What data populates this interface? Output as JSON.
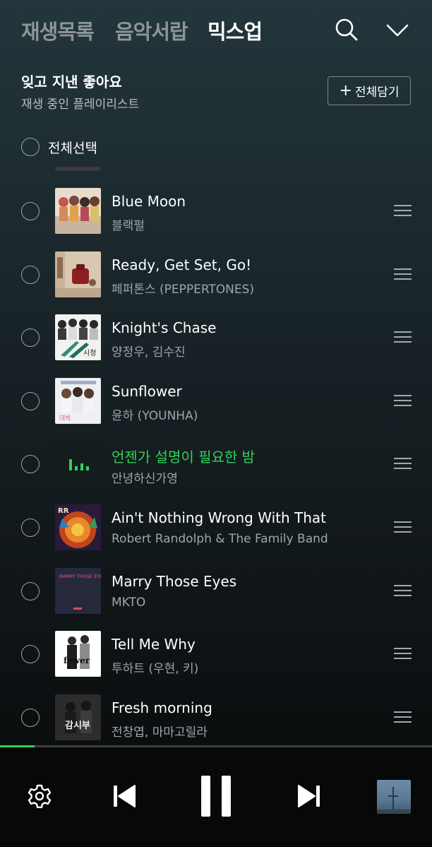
{
  "tabs": [
    {
      "label": "재생목록",
      "active": false
    },
    {
      "label": "음악서랍",
      "active": false
    },
    {
      "label": "믹스업",
      "active": true
    }
  ],
  "icons": {
    "search": "search-icon",
    "collapse": "chevron-down-icon"
  },
  "playlist": {
    "title": "잊고 지낸 좋아요",
    "subtitle": "재생 중인 플레이리스트",
    "add_all_label": "전체담기",
    "select_all_label": "전체선택"
  },
  "songs": [
    {
      "title": "Blue Moon",
      "artist": "블랙펄",
      "playing": false
    },
    {
      "title": "Ready, Get Set, Go!",
      "artist": "페퍼톤스 (PEPPERTONES)",
      "playing": false
    },
    {
      "title": "Knight's Chase",
      "artist": "양정우, 김수진",
      "playing": false
    },
    {
      "title": "Sunflower",
      "artist": "윤하 (YOUNHA)",
      "playing": false
    },
    {
      "title": "언젠가 설명이 필요한 밤",
      "artist": "안녕하신가영",
      "playing": true
    },
    {
      "title": "Ain't Nothing Wrong With That",
      "artist": "Robert Randolph & The Family Band",
      "playing": false
    },
    {
      "title": "Marry Those Eyes",
      "artist": "MKTO",
      "playing": false
    },
    {
      "title": "Tell Me Why",
      "artist": "투하트 (우현, 키)",
      "playing": false
    },
    {
      "title": "Fresh morning",
      "artist": "전창엽, 마마고릴라",
      "playing": false
    }
  ],
  "player": {
    "progress_fraction": 0.08,
    "state": "playing"
  },
  "colors": {
    "accent": "#30d158",
    "muted_text": "#9ea6a9",
    "player_bg": "#070808"
  }
}
